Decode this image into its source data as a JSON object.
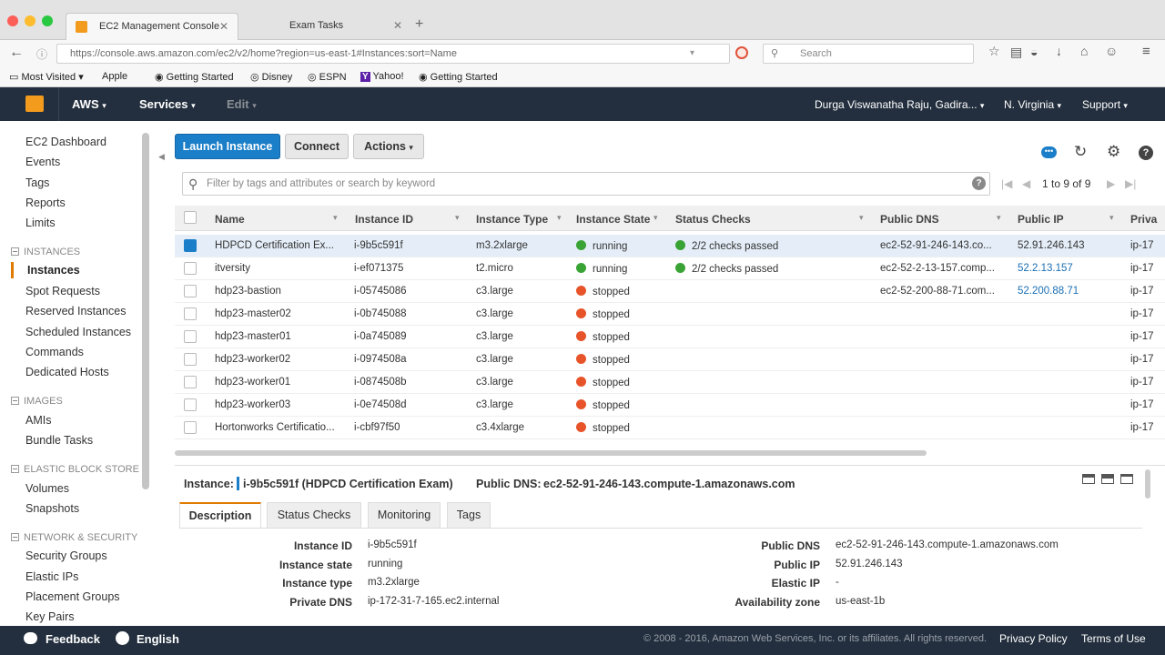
{
  "browser": {
    "tabs": [
      {
        "label": "EC2 Management Console",
        "active": true
      },
      {
        "label": "Exam Tasks",
        "active": false
      }
    ],
    "url": "https://console.aws.amazon.com/ec2/v2/home?region=us-east-1#Instances:sort=Name",
    "search_placeholder": "Search",
    "bookmarks": [
      "Most Visited",
      "Apple",
      "Getting Started",
      "Disney",
      "ESPN",
      "Yahoo!",
      "Getting Started"
    ]
  },
  "awsnav": {
    "brand": "AWS",
    "services": "Services",
    "edit": "Edit",
    "user": "Durga Viswanatha Raju, Gadira...",
    "region": "N. Virginia",
    "support": "Support"
  },
  "sidebar": {
    "top_items": [
      "EC2 Dashboard",
      "Events",
      "Tags",
      "Reports",
      "Limits"
    ],
    "instances_header": "INSTANCES",
    "instances_items": [
      "Instances",
      "Spot Requests",
      "Reserved Instances",
      "Scheduled Instances",
      "Commands",
      "Dedicated Hosts"
    ],
    "images_header": "IMAGES",
    "images_items": [
      "AMIs",
      "Bundle Tasks"
    ],
    "ebs_header": "ELASTIC BLOCK STORE",
    "ebs_items": [
      "Volumes",
      "Snapshots"
    ],
    "net_header": "NETWORK & SECURITY",
    "net_items": [
      "Security Groups",
      "Elastic IPs",
      "Placement Groups",
      "Key Pairs"
    ]
  },
  "toolbar": {
    "launch": "Launch Instance",
    "connect": "Connect",
    "actions": "Actions"
  },
  "filter": {
    "placeholder": "Filter by tags and attributes or search by keyword",
    "pager": "1 to 9 of 9"
  },
  "table": {
    "columns": [
      "Name",
      "Instance ID",
      "Instance Type",
      "Instance State",
      "Status Checks",
      "Public DNS",
      "Public IP",
      "Priva"
    ],
    "rows": [
      {
        "name": "HDPCD Certification Ex...",
        "id": "i-9b5c591f",
        "type": "m3.2xlarge",
        "state": "running",
        "checks": "2/2 checks passed",
        "dns": "ec2-52-91-246-143.co...",
        "ip": "52.91.246.143",
        "ip_link": false,
        "priv": "ip-17",
        "selected": true
      },
      {
        "name": "itversity",
        "id": "i-ef071375",
        "type": "t2.micro",
        "state": "running",
        "checks": "2/2 checks passed",
        "dns": "ec2-52-2-13-157.comp...",
        "ip": "52.2.13.157",
        "ip_link": true,
        "priv": "ip-17",
        "selected": false
      },
      {
        "name": "hdp23-bastion",
        "id": "i-05745086",
        "type": "c3.large",
        "state": "stopped",
        "checks": "",
        "dns": "ec2-52-200-88-71.com...",
        "ip": "52.200.88.71",
        "ip_link": true,
        "priv": "ip-17",
        "selected": false
      },
      {
        "name": "hdp23-master02",
        "id": "i-0b745088",
        "type": "c3.large",
        "state": "stopped",
        "checks": "",
        "dns": "",
        "ip": "",
        "ip_link": false,
        "priv": "ip-17",
        "selected": false
      },
      {
        "name": "hdp23-master01",
        "id": "i-0a745089",
        "type": "c3.large",
        "state": "stopped",
        "checks": "",
        "dns": "",
        "ip": "",
        "ip_link": false,
        "priv": "ip-17",
        "selected": false
      },
      {
        "name": "hdp23-worker02",
        "id": "i-0974508a",
        "type": "c3.large",
        "state": "stopped",
        "checks": "",
        "dns": "",
        "ip": "",
        "ip_link": false,
        "priv": "ip-17",
        "selected": false
      },
      {
        "name": "hdp23-worker01",
        "id": "i-0874508b",
        "type": "c3.large",
        "state": "stopped",
        "checks": "",
        "dns": "",
        "ip": "",
        "ip_link": false,
        "priv": "ip-17",
        "selected": false
      },
      {
        "name": "hdp23-worker03",
        "id": "i-0e74508d",
        "type": "c3.large",
        "state": "stopped",
        "checks": "",
        "dns": "",
        "ip": "",
        "ip_link": false,
        "priv": "ip-17",
        "selected": false
      },
      {
        "name": "Hortonworks Certificatio...",
        "id": "i-cbf97f50",
        "type": "c3.4xlarge",
        "state": "stopped",
        "checks": "",
        "dns": "",
        "ip": "",
        "ip_link": false,
        "priv": "ip-17",
        "selected": false
      }
    ]
  },
  "detail": {
    "instance_label": "Instance:",
    "instance_value": "i-9b5c591f (HDPCD Certification Exam)",
    "dns_label": "Public DNS:",
    "dns_value": "ec2-52-91-246-143.compute-1.amazonaws.com",
    "tabs": [
      "Description",
      "Status Checks",
      "Monitoring",
      "Tags"
    ],
    "left": [
      {
        "label": "Instance ID",
        "value": "i-9b5c591f"
      },
      {
        "label": "Instance state",
        "value": "running"
      },
      {
        "label": "Instance type",
        "value": "m3.2xlarge"
      },
      {
        "label": "Private DNS",
        "value": "ip-172-31-7-165.ec2.internal"
      }
    ],
    "right": [
      {
        "label": "Public DNS",
        "value": "ec2-52-91-246-143.compute-1.amazonaws.com"
      },
      {
        "label": "Public IP",
        "value": "52.91.246.143"
      },
      {
        "label": "Elastic IP",
        "value": "-"
      },
      {
        "label": "Availability zone",
        "value": "us-east-1b"
      }
    ]
  },
  "footer": {
    "feedback": "Feedback",
    "language": "English",
    "copyright": "© 2008 - 2016, Amazon Web Services, Inc. or its affiliates. All rights reserved.",
    "privacy": "Privacy Policy",
    "terms": "Terms of Use"
  },
  "colors": {
    "running": "#3aa335",
    "stopped": "#e8542a",
    "primary": "#1a7ec8",
    "nav": "#232f3e"
  }
}
